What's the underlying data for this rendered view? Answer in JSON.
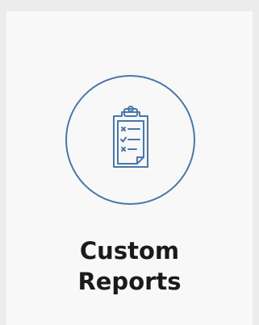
{
  "card": {
    "title_line1": "Custom",
    "title_line2": "Reports",
    "icon": "clipboard-checklist-icon",
    "accent_color": "#4a77a8"
  }
}
